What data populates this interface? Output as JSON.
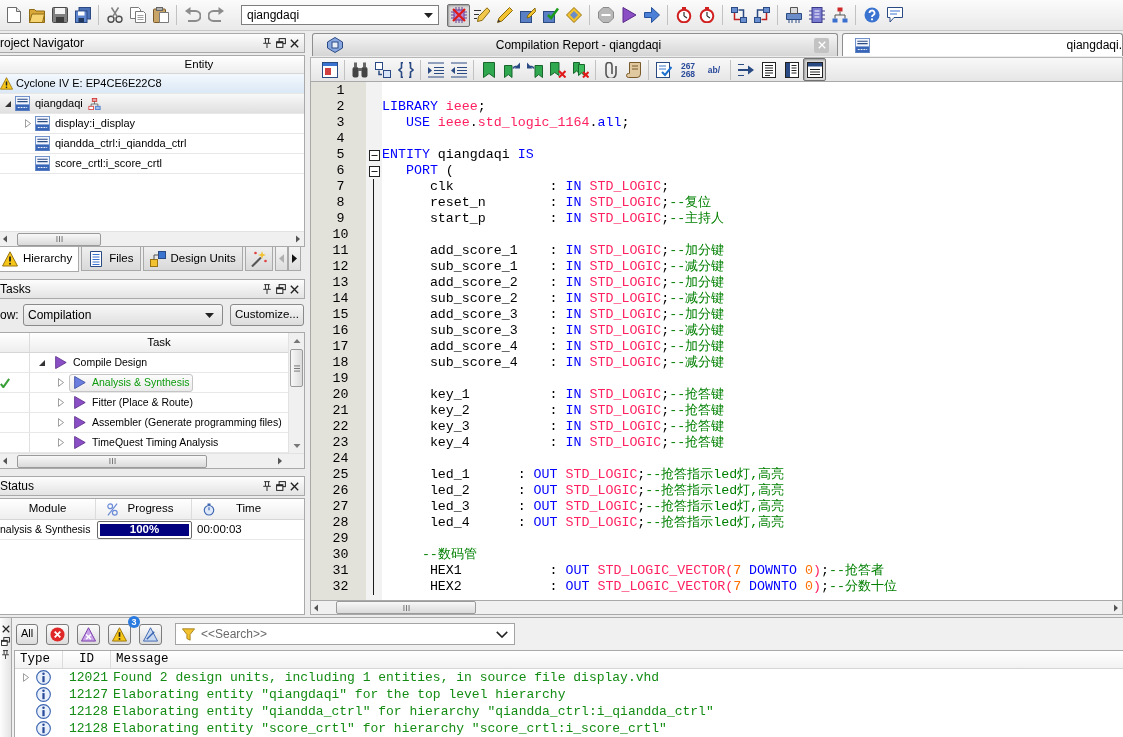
{
  "toolbar": {
    "file_buttons": [
      {
        "pressed": false
      },
      {
        "pressed": false
      },
      {
        "pressed": false
      },
      {
        "pressed": false
      },
      {
        "pressed": false
      },
      {
        "pressed": false
      },
      {
        "pressed": false
      },
      {
        "pressed": false
      },
      {
        "pressed": false
      }
    ],
    "project": "qiangdaqi",
    "tool_buttons": [
      {
        "pressed": true
      },
      {
        "pressed": false
      },
      {
        "pressed": false
      },
      {
        "pressed": false
      },
      {
        "pressed": false
      },
      {
        "pressed": false
      },
      {
        "pressed": false
      },
      {
        "pressed": false
      },
      {
        "pressed": false
      },
      {
        "pressed": false
      },
      {
        "pressed": false
      },
      {
        "pressed": false
      },
      {
        "pressed": false
      },
      {
        "pressed": false
      },
      {
        "pressed": false
      },
      {
        "pressed": false
      },
      {
        "pressed": false
      },
      {
        "pressed": false
      }
    ]
  },
  "project_navigator": {
    "title": "roject Navigator",
    "column": "Entity",
    "tree": [
      {
        "label": "Cyclone IV E: EP4CE6E22C8",
        "kind": "device",
        "selected": false,
        "children": [
          {
            "label": "qiangdaqi",
            "kind": "top",
            "selected": true,
            "expanded": true,
            "children": [
              {
                "label": "display:i_display",
                "kind": "entity",
                "selected": false,
                "expanded": false
              },
              {
                "label": "qiandda_ctrl:i_qiandda_ctrl",
                "kind": "entity",
                "selected": false
              },
              {
                "label": "score_crtl:i_score_crtl",
                "kind": "entity",
                "selected": false
              }
            ]
          }
        ]
      }
    ],
    "tabs": [
      {
        "label": "Hierarchy",
        "selected": true
      },
      {
        "label": "Files",
        "selected": false
      },
      {
        "label": "Design Units",
        "selected": false
      },
      {
        "selected": false
      }
    ]
  },
  "tasks": {
    "title": "Tasks",
    "flow_label": "ow:",
    "flow": "Compilation",
    "customize_button": "Customize...",
    "column": "Task",
    "items": [
      {
        "label": "Compile Design",
        "expanded": true,
        "done": false,
        "selected": false,
        "children": [
          {
            "label": "Analysis & Synthesis",
            "expanded": false,
            "done": true,
            "selected": true
          },
          {
            "label": "Fitter (Place & Route)",
            "expanded": false,
            "done": false,
            "selected": false
          },
          {
            "label": "Assembler (Generate programming files)",
            "expanded": false,
            "done": false,
            "selected": false
          },
          {
            "label": "TimeQuest Timing Analysis",
            "expanded": false,
            "done": false,
            "selected": false
          }
        ]
      }
    ]
  },
  "status": {
    "title": "Status",
    "columns": [
      "Module",
      "Progress",
      "Time"
    ],
    "rows": [
      {
        "module": "nalysis & Synthesis",
        "level": 1,
        "reading": "100%",
        "time": "00:00:03"
      }
    ]
  },
  "editor": {
    "tabs": [
      {
        "kind": "report",
        "label": "Compilation Report - qiangdaqi",
        "selected": false
      },
      {
        "kind": "file",
        "label": "qiangdaqi.",
        "selected": true
      }
    ],
    "toolbar": [
      {
        "pressed": false
      },
      {
        "pressed": false
      },
      {
        "pressed": false
      },
      {
        "pressed": false
      },
      {
        "pressed": false
      },
      {
        "pressed": false
      },
      {
        "pressed": false
      },
      {
        "pressed": false
      },
      {
        "pressed": false
      },
      {
        "pressed": false
      },
      {
        "pressed": false
      },
      {
        "pressed": false
      },
      {
        "pressed": false
      },
      {
        "pressed": false
      },
      {
        "pressed": false,
        "label": "267 268"
      },
      {
        "pressed": false,
        "label": "ab/"
      },
      {
        "pressed": false
      },
      {
        "pressed": false
      },
      {
        "pressed": false
      },
      {
        "pressed": true
      }
    ],
    "lines": [
      {
        "number": "1"
      },
      {
        "number": "2",
        "tokens": [
          {
            "kind": "keyword",
            "text": "LIBRARY"
          },
          {
            "kind": "type",
            "text": " ieee"
          },
          {
            "kind": "plain",
            "text": ";"
          }
        ]
      },
      {
        "number": "3",
        "tokens": [
          {
            "kind": "keyword",
            "text": "   USE"
          },
          {
            "kind": "type",
            "text": " ieee"
          },
          {
            "kind": "plain",
            "text": "."
          },
          {
            "kind": "type",
            "text": "std_logic_1164"
          },
          {
            "kind": "plain",
            "text": "."
          },
          {
            "kind": "keyword",
            "text": "all"
          },
          {
            "kind": "plain",
            "text": ";"
          }
        ]
      },
      {
        "number": "4"
      },
      {
        "number": "5",
        "expanded": true,
        "tokens": [
          {
            "kind": "keyword",
            "text": "ENTITY"
          },
          {
            "kind": "plain",
            "text": " qiangdaqi "
          },
          {
            "kind": "keyword",
            "text": "IS"
          }
        ]
      },
      {
        "number": "6",
        "expanded": true,
        "tokens": [
          {
            "kind": "keyword",
            "text": "   PORT"
          },
          {
            "kind": "plain",
            "text": " ("
          }
        ]
      },
      {
        "number": "7",
        "in_fold": true,
        "tokens": [
          {
            "kind": "plain",
            "text": "      clk            : "
          },
          {
            "kind": "keyword",
            "text": "IN"
          },
          {
            "kind": "type",
            "text": " STD_LOGIC"
          },
          {
            "kind": "plain",
            "text": ";"
          }
        ]
      },
      {
        "number": "8",
        "in_fold": true,
        "tokens": [
          {
            "kind": "plain",
            "text": "      reset_n        : "
          },
          {
            "kind": "keyword",
            "text": "IN"
          },
          {
            "kind": "type",
            "text": " STD_LOGIC"
          },
          {
            "kind": "plain",
            "text": ";"
          },
          {
            "kind": "comment",
            "text": "--复位"
          }
        ]
      },
      {
        "number": "9",
        "in_fold": true,
        "tokens": [
          {
            "kind": "plain",
            "text": "      start_p        : "
          },
          {
            "kind": "keyword",
            "text": "IN"
          },
          {
            "kind": "type",
            "text": " STD_LOGIC"
          },
          {
            "kind": "plain",
            "text": ";"
          },
          {
            "kind": "comment",
            "text": "--主持人"
          }
        ]
      },
      {
        "number": "10",
        "in_fold": true
      },
      {
        "number": "11",
        "in_fold": true,
        "tokens": [
          {
            "kind": "plain",
            "text": "      add_score_1    : "
          },
          {
            "kind": "keyword",
            "text": "IN"
          },
          {
            "kind": "type",
            "text": " STD_LOGIC"
          },
          {
            "kind": "plain",
            "text": ";"
          },
          {
            "kind": "comment",
            "text": "--加分键"
          }
        ]
      },
      {
        "number": "12",
        "in_fold": true,
        "tokens": [
          {
            "kind": "plain",
            "text": "      sub_score_1    : "
          },
          {
            "kind": "keyword",
            "text": "IN"
          },
          {
            "kind": "type",
            "text": " STD_LOGIC"
          },
          {
            "kind": "plain",
            "text": ";"
          },
          {
            "kind": "comment",
            "text": "--减分键"
          }
        ]
      },
      {
        "number": "13",
        "in_fold": true,
        "tokens": [
          {
            "kind": "plain",
            "text": "      add_score_2    : "
          },
          {
            "kind": "keyword",
            "text": "IN"
          },
          {
            "kind": "type",
            "text": " STD_LOGIC"
          },
          {
            "kind": "plain",
            "text": ";"
          },
          {
            "kind": "comment",
            "text": "--加分键"
          }
        ]
      },
      {
        "number": "14",
        "in_fold": true,
        "tokens": [
          {
            "kind": "plain",
            "text": "      sub_score_2    : "
          },
          {
            "kind": "keyword",
            "text": "IN"
          },
          {
            "kind": "type",
            "text": " STD_LOGIC"
          },
          {
            "kind": "plain",
            "text": ";"
          },
          {
            "kind": "comment",
            "text": "--减分键"
          }
        ]
      },
      {
        "number": "15",
        "in_fold": true,
        "tokens": [
          {
            "kind": "plain",
            "text": "      add_score_3    : "
          },
          {
            "kind": "keyword",
            "text": "IN"
          },
          {
            "kind": "type",
            "text": " STD_LOGIC"
          },
          {
            "kind": "plain",
            "text": ";"
          },
          {
            "kind": "comment",
            "text": "--加分键"
          }
        ]
      },
      {
        "number": "16",
        "in_fold": true,
        "tokens": [
          {
            "kind": "plain",
            "text": "      sub_score_3    : "
          },
          {
            "kind": "keyword",
            "text": "IN"
          },
          {
            "kind": "type",
            "text": " STD_LOGIC"
          },
          {
            "kind": "plain",
            "text": ";"
          },
          {
            "kind": "comment",
            "text": "--减分键"
          }
        ]
      },
      {
        "number": "17",
        "in_fold": true,
        "tokens": [
          {
            "kind": "plain",
            "text": "      add_score_4    : "
          },
          {
            "kind": "keyword",
            "text": "IN"
          },
          {
            "kind": "type",
            "text": " STD_LOGIC"
          },
          {
            "kind": "plain",
            "text": ";"
          },
          {
            "kind": "comment",
            "text": "--加分键"
          }
        ]
      },
      {
        "number": "18",
        "in_fold": true,
        "tokens": [
          {
            "kind": "plain",
            "text": "      sub_score_4    : "
          },
          {
            "kind": "keyword",
            "text": "IN"
          },
          {
            "kind": "type",
            "text": " STD_LOGIC"
          },
          {
            "kind": "plain",
            "text": ";"
          },
          {
            "kind": "comment",
            "text": "--减分键"
          }
        ]
      },
      {
        "number": "19",
        "in_fold": true
      },
      {
        "number": "20",
        "in_fold": true,
        "tokens": [
          {
            "kind": "plain",
            "text": "      key_1          : "
          },
          {
            "kind": "keyword",
            "text": "IN"
          },
          {
            "kind": "type",
            "text": " STD_LOGIC"
          },
          {
            "kind": "plain",
            "text": ";"
          },
          {
            "kind": "comment",
            "text": "--抢答键"
          }
        ]
      },
      {
        "number": "21",
        "in_fold": true,
        "tokens": [
          {
            "kind": "plain",
            "text": "      key_2          : "
          },
          {
            "kind": "keyword",
            "text": "IN"
          },
          {
            "kind": "type",
            "text": " STD_LOGIC"
          },
          {
            "kind": "plain",
            "text": ";"
          },
          {
            "kind": "comment",
            "text": "--抢答键"
          }
        ]
      },
      {
        "number": "22",
        "in_fold": true,
        "tokens": [
          {
            "kind": "plain",
            "text": "      key_3          : "
          },
          {
            "kind": "keyword",
            "text": "IN"
          },
          {
            "kind": "type",
            "text": " STD_LOGIC"
          },
          {
            "kind": "plain",
            "text": ";"
          },
          {
            "kind": "comment",
            "text": "--抢答键"
          }
        ]
      },
      {
        "number": "23",
        "in_fold": true,
        "tokens": [
          {
            "kind": "plain",
            "text": "      key_4          : "
          },
          {
            "kind": "keyword",
            "text": "IN"
          },
          {
            "kind": "type",
            "text": " STD_LOGIC"
          },
          {
            "kind": "plain",
            "text": ";"
          },
          {
            "kind": "comment",
            "text": "--抢答键"
          }
        ]
      },
      {
        "number": "24",
        "in_fold": true
      },
      {
        "number": "25",
        "in_fold": true,
        "tokens": [
          {
            "kind": "plain",
            "text": "      led_1      : "
          },
          {
            "kind": "keyword",
            "text": "OUT"
          },
          {
            "kind": "type",
            "text": " STD_LOGIC"
          },
          {
            "kind": "plain",
            "text": ";"
          },
          {
            "kind": "comment",
            "text": "--抢答指示led灯,高亮"
          }
        ]
      },
      {
        "number": "26",
        "in_fold": true,
        "tokens": [
          {
            "kind": "plain",
            "text": "      led_2      : "
          },
          {
            "kind": "keyword",
            "text": "OUT"
          },
          {
            "kind": "type",
            "text": " STD_LOGIC"
          },
          {
            "kind": "plain",
            "text": ";"
          },
          {
            "kind": "comment",
            "text": "--抢答指示led灯,高亮"
          }
        ]
      },
      {
        "number": "27",
        "in_fold": true,
        "tokens": [
          {
            "kind": "plain",
            "text": "      led_3      : "
          },
          {
            "kind": "keyword",
            "text": "OUT"
          },
          {
            "kind": "type",
            "text": " STD_LOGIC"
          },
          {
            "kind": "plain",
            "text": ";"
          },
          {
            "kind": "comment",
            "text": "--抢答指示led灯,高亮"
          }
        ]
      },
      {
        "number": "28",
        "in_fold": true,
        "tokens": [
          {
            "kind": "plain",
            "text": "      led_4      : "
          },
          {
            "kind": "keyword",
            "text": "OUT"
          },
          {
            "kind": "type",
            "text": " STD_LOGIC"
          },
          {
            "kind": "plain",
            "text": ";"
          },
          {
            "kind": "comment",
            "text": "--抢答指示led灯,高亮"
          }
        ]
      },
      {
        "number": "29",
        "in_fold": true
      },
      {
        "number": "30",
        "in_fold": true,
        "tokens": [
          {
            "kind": "comment",
            "text": "     --数码管"
          }
        ]
      },
      {
        "number": "31",
        "in_fold": true,
        "tokens": [
          {
            "kind": "plain",
            "text": "      HEX1           : "
          },
          {
            "kind": "keyword",
            "text": "OUT"
          },
          {
            "kind": "type",
            "text": " STD_LOGIC_VECTOR("
          },
          {
            "kind": "number",
            "text": "7"
          },
          {
            "kind": "keyword",
            "text": " DOWNTO"
          },
          {
            "kind": "number",
            "text": " 0"
          },
          {
            "kind": "type",
            "text": ")"
          },
          {
            "kind": "plain",
            "text": ";"
          },
          {
            "kind": "comment",
            "text": "--抢答者"
          }
        ]
      },
      {
        "number": "32",
        "in_fold": true,
        "tokens": [
          {
            "kind": "plain",
            "text": "      HEX2           : "
          },
          {
            "kind": "keyword",
            "text": "OUT"
          },
          {
            "kind": "type",
            "text": " STD_LOGIC_VECTOR("
          },
          {
            "kind": "number",
            "text": "7"
          },
          {
            "kind": "keyword",
            "text": " DOWNTO"
          },
          {
            "kind": "number",
            "text": " 0"
          },
          {
            "kind": "type",
            "text": ")"
          },
          {
            "kind": "plain",
            "text": ";"
          },
          {
            "kind": "comment",
            "text": "--分数十位"
          }
        ]
      }
    ]
  },
  "messages": {
    "filters": [
      {
        "kind": "all",
        "label": "All"
      },
      {
        "kind": "error"
      },
      {
        "kind": "critical"
      },
      {
        "kind": "warning",
        "badge": "3"
      },
      {
        "kind": "suppressed"
      }
    ],
    "search": {
      "placeholder": "<<Search>>"
    },
    "columns": [
      "Type",
      "ID",
      "Message"
    ],
    "rows": [
      {
        "kind": "info",
        "expanded": false,
        "id": "12021",
        "text": "Found 2 design units, including 1 entities, in source file display.vhd"
      },
      {
        "kind": "info",
        "id": "12127",
        "text": "Elaborating entity \"qiangdaqi\" for the top level hierarchy"
      },
      {
        "kind": "info",
        "id": "12128",
        "text": "Elaborating entity \"qiandda_ctrl\" for hierarchy \"qiandda_ctrl:i_qiandda_ctrl\""
      },
      {
        "kind": "info",
        "id": "12128",
        "text": "Elaborating entity \"score_crtl\" for hierarchy \"score_crtl:i_score_crtl\""
      }
    ]
  }
}
